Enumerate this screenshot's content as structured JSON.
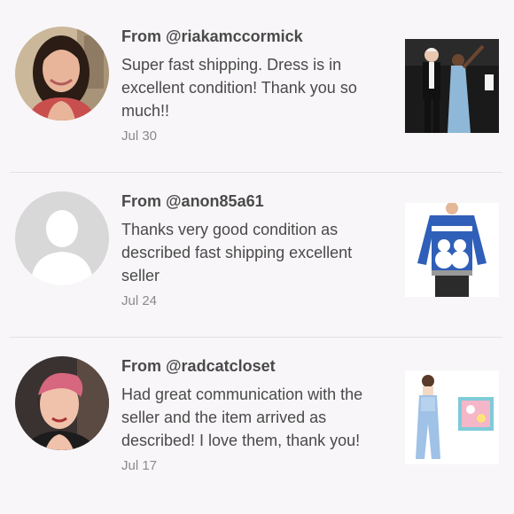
{
  "reviews": [
    {
      "from": "From @riakamccormick",
      "text": "Super fast shipping. Dress is in excellent condition! Thank you so much!!",
      "date": "Jul 30"
    },
    {
      "from": "From @anon85a61",
      "text": "Thanks very good condition as described fast shipping excellent seller",
      "date": "Jul 24"
    },
    {
      "from": "From @radcatcloset",
      "text": "Had great communication with the seller and the item arrived as described! I love them, thank you!",
      "date": "Jul 17"
    }
  ],
  "colors": {
    "background": "#f8f6f8",
    "text": "#4a4a4a",
    "muted": "#8a8a8a",
    "placeholder_avatar": "#d8d8d8"
  }
}
